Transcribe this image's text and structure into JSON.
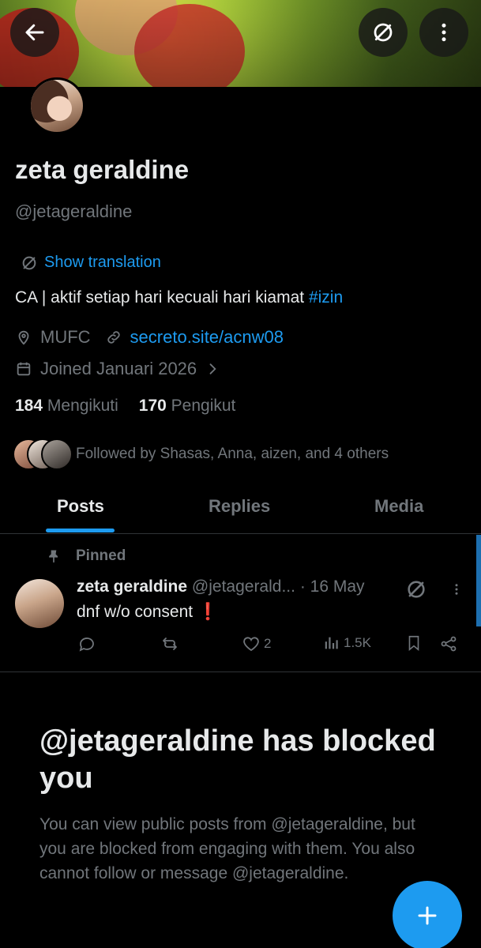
{
  "header": {
    "back_icon": "arrow-left-icon",
    "translate_icon": "translate-icon",
    "more_icon": "more-vertical-icon"
  },
  "profile": {
    "name": "zeta geraldine",
    "handle": "@jetageraldine",
    "show_translation": "Show translation",
    "bio_text": "CA | aktif setiap hari kecuali hari kiamat ",
    "bio_hashtag": "#izin",
    "location": "MUFC",
    "website": "secreto.site/acnw08",
    "joined": "Joined Januari 2026",
    "following_count": "184",
    "following_label": "Mengikuti",
    "followers_count": "170",
    "followers_label": "Pengikut",
    "followed_by": "Followed by Shasas, Anna, aizen, and 4 others"
  },
  "tabs": [
    {
      "label": "Posts",
      "active": true
    },
    {
      "label": "Replies",
      "active": false
    },
    {
      "label": "Media",
      "active": false
    }
  ],
  "pinned_post": {
    "pinned_label": "Pinned",
    "author_name": "zeta geraldine",
    "author_handle": "@jetagerald...",
    "date": "· 16 May",
    "text": "dnf w/o consent",
    "emoji": "❗",
    "likes": "2",
    "views": "1.5K"
  },
  "blocked": {
    "title": "@jetageraldine has blocked you",
    "message": "You can view public posts from @jetageraldine, but you are blocked from engaging with them. You also cannot follow or message @jetageraldine."
  },
  "colors": {
    "accent": "#1d9bf0",
    "background": "#000000",
    "muted": "#71767b",
    "text": "#e7e9ea"
  }
}
